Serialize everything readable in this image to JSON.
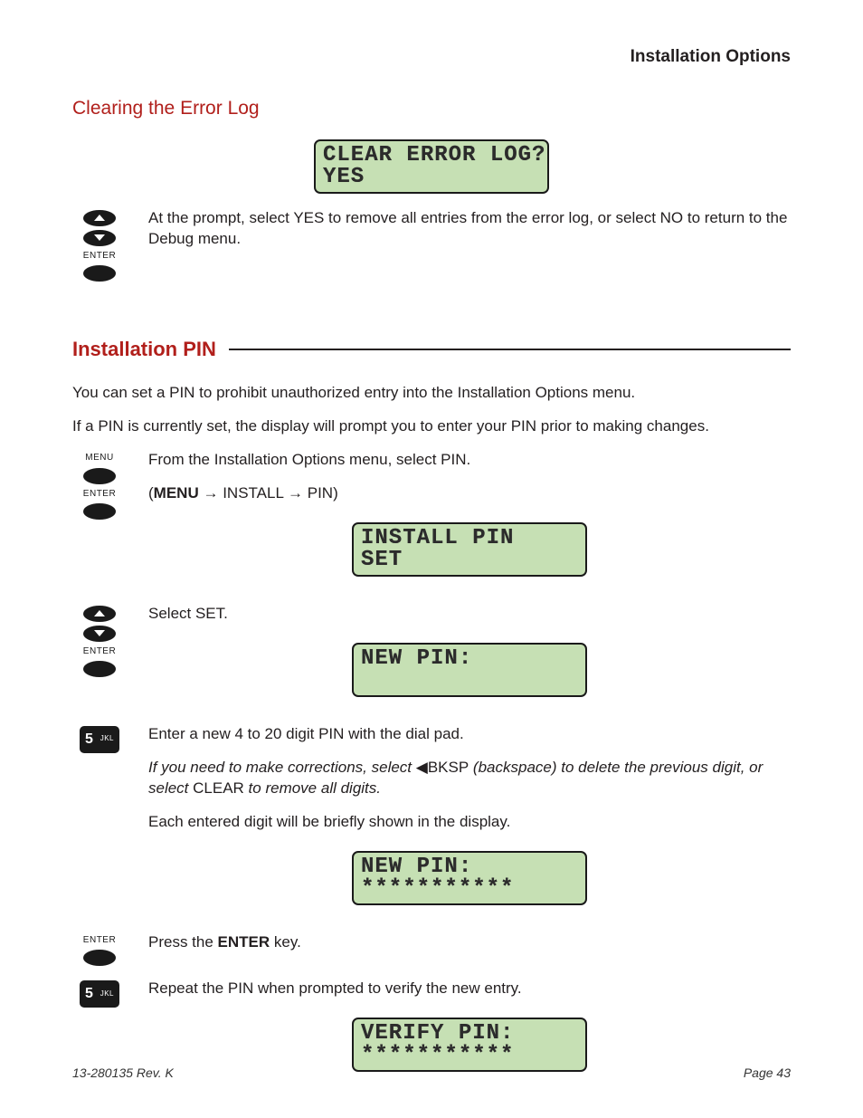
{
  "header": {
    "section": "Installation Options"
  },
  "sec_clear": {
    "heading": "Clearing the Error Log",
    "lcd1_line1": "CLEAR ERROR LOG?",
    "lcd1_line2": "YES",
    "para": "At the prompt, select YES to remove all entries from the error log, or select NO to return to the Debug menu."
  },
  "sec_pin": {
    "heading": "Installation PIN",
    "intro1": "You can set a PIN to prohibit unauthorized entry into the Installation Options menu.",
    "intro2": "If a PIN is currently set, the display will prompt you to enter your PIN prior to making changes.",
    "step1_text_a": "From the Installation Options menu, select PIN.",
    "step1_text_b_prefix": "(",
    "step1_menu": "MENU",
    "step1_arrow1": " → ",
    "step1_install": "INSTALL",
    "step1_arrow2": " → ",
    "step1_pin": "PIN)",
    "lcd2_line1": "INSTALL PIN",
    "lcd2_line2": "SET",
    "step2_text": "Select SET.",
    "lcd3_line1": "NEW PIN:",
    "lcd3_line2": " ",
    "step3_text": "Enter a new 4 to 20 digit PIN with the dial pad.",
    "step3_note_a": "If you need to make corrections, select ",
    "step3_bksp": "◀BKSP",
    "step3_note_b": " (backspace) to delete the previous digit, or select ",
    "step3_clear": "CLEAR",
    "step3_note_c": " to remove all digits.",
    "step3_tail": "Each entered digit will be briefly shown in the display.",
    "lcd4_line1": "NEW PIN:",
    "lcd4_line2": "***********",
    "step4_a": "Press the ",
    "step4_enter": "ENTER",
    "step4_b": " key.",
    "step5_text": "Repeat the PIN when prompted to verify the new entry.",
    "lcd5_line1": "VERIFY PIN:",
    "lcd5_line2": "***********"
  },
  "labels": {
    "menu": "MENU",
    "enter": "ENTER",
    "key5_num": "5",
    "key5_abc": "JKL"
  },
  "footer": {
    "left": "13-280135  Rev. K",
    "right": "Page 43"
  }
}
